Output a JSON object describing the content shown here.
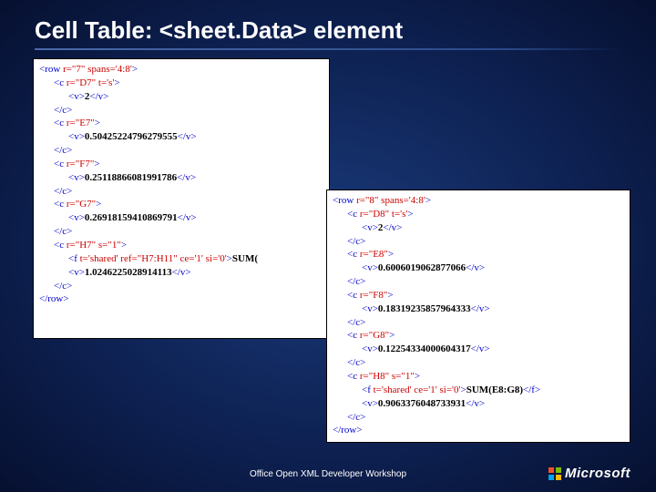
{
  "title": "Cell Table: <sheet.Data> element",
  "footer": "Office Open XML Developer Workshop",
  "brand": "Microsoft",
  "left_box": [
    {
      "cls": "ln",
      "parts": [
        {
          "t": "<row ",
          "c": "tag"
        },
        {
          "t": "r=\"7\" spans='4:8'",
          "c": "attr"
        },
        {
          "t": ">",
          "c": "tag"
        }
      ]
    },
    {
      "cls": "ln ind1",
      "parts": [
        {
          "t": "<c ",
          "c": "tag"
        },
        {
          "t": "r=\"D7\" t='s'",
          "c": "attr"
        },
        {
          "t": ">",
          "c": "tag"
        }
      ]
    },
    {
      "cls": "ln ind2",
      "parts": [
        {
          "t": "<v>",
          "c": "tag"
        },
        {
          "t": "2",
          "c": "txt"
        },
        {
          "t": "</v>",
          "c": "tag"
        }
      ]
    },
    {
      "cls": "ln ind1",
      "parts": [
        {
          "t": "</c>",
          "c": "tag"
        }
      ]
    },
    {
      "cls": "ln ind1",
      "parts": [
        {
          "t": "<c ",
          "c": "tag"
        },
        {
          "t": "r=\"E7\"",
          "c": "attr"
        },
        {
          "t": ">",
          "c": "tag"
        }
      ]
    },
    {
      "cls": "ln ind2",
      "parts": [
        {
          "t": "<v>",
          "c": "tag"
        },
        {
          "t": "0.50425224796279555",
          "c": "txt"
        },
        {
          "t": "</v>",
          "c": "tag"
        }
      ]
    },
    {
      "cls": "ln ind1",
      "parts": [
        {
          "t": "</c>",
          "c": "tag"
        }
      ]
    },
    {
      "cls": "ln ind1",
      "parts": [
        {
          "t": "<c ",
          "c": "tag"
        },
        {
          "t": "r=\"F7\"",
          "c": "attr"
        },
        {
          "t": ">",
          "c": "tag"
        }
      ]
    },
    {
      "cls": "ln ind2",
      "parts": [
        {
          "t": "<v>",
          "c": "tag"
        },
        {
          "t": "0.25118866081991786",
          "c": "txt"
        },
        {
          "t": "</v>",
          "c": "tag"
        }
      ]
    },
    {
      "cls": "ln ind1",
      "parts": [
        {
          "t": "</c>",
          "c": "tag"
        }
      ]
    },
    {
      "cls": "ln ind1",
      "parts": [
        {
          "t": "<c ",
          "c": "tag"
        },
        {
          "t": "r=\"G7\"",
          "c": "attr"
        },
        {
          "t": ">",
          "c": "tag"
        }
      ]
    },
    {
      "cls": "ln ind2",
      "parts": [
        {
          "t": "<v>",
          "c": "tag"
        },
        {
          "t": "0.26918159410869791",
          "c": "txt"
        },
        {
          "t": "</v>",
          "c": "tag"
        }
      ]
    },
    {
      "cls": "ln ind1",
      "parts": [
        {
          "t": "</c>",
          "c": "tag"
        }
      ]
    },
    {
      "cls": "ln ind1",
      "parts": [
        {
          "t": "<c ",
          "c": "tag"
        },
        {
          "t": "r=\"H7\" s=\"1\"",
          "c": "attr"
        },
        {
          "t": ">",
          "c": "tag"
        }
      ]
    },
    {
      "cls": "ln ind2",
      "parts": [
        {
          "t": "<f ",
          "c": "tag"
        },
        {
          "t": "t='shared' ref=\"H7:H11\" ce='1' si='0'",
          "c": "attr"
        },
        {
          "t": ">",
          "c": "tag"
        },
        {
          "t": "SUM(",
          "c": "txt"
        }
      ]
    },
    {
      "cls": "ln ind2",
      "parts": [
        {
          "t": "<v>",
          "c": "tag"
        },
        {
          "t": "1.0246225028914113",
          "c": "txt"
        },
        {
          "t": "</v>",
          "c": "tag"
        }
      ]
    },
    {
      "cls": "ln ind1",
      "parts": [
        {
          "t": "</c>",
          "c": "tag"
        }
      ]
    },
    {
      "cls": "ln",
      "parts": [
        {
          "t": "</row>",
          "c": "tag"
        }
      ]
    }
  ],
  "right_box": [
    {
      "cls": "ln",
      "parts": [
        {
          "t": "<row ",
          "c": "tag"
        },
        {
          "t": "r=\"8\" spans='4:8'",
          "c": "attr"
        },
        {
          "t": ">",
          "c": "tag"
        }
      ]
    },
    {
      "cls": "ln ind1",
      "parts": [
        {
          "t": "<c ",
          "c": "tag"
        },
        {
          "t": "r=\"D8\" t='s'",
          "c": "attr"
        },
        {
          "t": ">",
          "c": "tag"
        }
      ]
    },
    {
      "cls": "ln ind2",
      "parts": [
        {
          "t": "<v>",
          "c": "tag"
        },
        {
          "t": "2",
          "c": "txt"
        },
        {
          "t": "</v>",
          "c": "tag"
        }
      ]
    },
    {
      "cls": "ln ind1",
      "parts": [
        {
          "t": "</c>",
          "c": "tag"
        }
      ]
    },
    {
      "cls": "ln ind1",
      "parts": [
        {
          "t": "<c ",
          "c": "tag"
        },
        {
          "t": "r=\"E8\"",
          "c": "attr"
        },
        {
          "t": ">",
          "c": "tag"
        }
      ]
    },
    {
      "cls": "ln ind2",
      "parts": [
        {
          "t": "<v>",
          "c": "tag"
        },
        {
          "t": "0.6006019062877066",
          "c": "txt"
        },
        {
          "t": "</v>",
          "c": "tag"
        }
      ]
    },
    {
      "cls": "ln ind1",
      "parts": [
        {
          "t": "</c>",
          "c": "tag"
        }
      ]
    },
    {
      "cls": "ln ind1",
      "parts": [
        {
          "t": "<c ",
          "c": "tag"
        },
        {
          "t": "r=\"F8\"",
          "c": "attr"
        },
        {
          "t": ">",
          "c": "tag"
        }
      ]
    },
    {
      "cls": "ln ind2",
      "parts": [
        {
          "t": "<v>",
          "c": "tag"
        },
        {
          "t": "0.18319235857964333",
          "c": "txt"
        },
        {
          "t": "</v>",
          "c": "tag"
        }
      ]
    },
    {
      "cls": "ln ind1",
      "parts": [
        {
          "t": "</c>",
          "c": "tag"
        }
      ]
    },
    {
      "cls": "ln ind1",
      "parts": [
        {
          "t": "<c ",
          "c": "tag"
        },
        {
          "t": "r=\"G8\"",
          "c": "attr"
        },
        {
          "t": ">",
          "c": "tag"
        }
      ]
    },
    {
      "cls": "ln ind2",
      "parts": [
        {
          "t": "<v>",
          "c": "tag"
        },
        {
          "t": "0.12254334000604317",
          "c": "txt"
        },
        {
          "t": "</v>",
          "c": "tag"
        }
      ]
    },
    {
      "cls": "ln ind1",
      "parts": [
        {
          "t": "</c>",
          "c": "tag"
        }
      ]
    },
    {
      "cls": "ln ind1",
      "parts": [
        {
          "t": "<c ",
          "c": "tag"
        },
        {
          "t": "r=\"H8\" s=\"1\"",
          "c": "attr"
        },
        {
          "t": ">",
          "c": "tag"
        }
      ]
    },
    {
      "cls": "ln ind2",
      "parts": [
        {
          "t": "<f ",
          "c": "tag"
        },
        {
          "t": "t='shared' ce='1' si='0'",
          "c": "attr"
        },
        {
          "t": ">",
          "c": "tag"
        },
        {
          "t": "SUM(E8:G8)",
          "c": "txt"
        },
        {
          "t": "</f>",
          "c": "tag"
        }
      ]
    },
    {
      "cls": "ln ind2",
      "parts": [
        {
          "t": "<v>",
          "c": "tag"
        },
        {
          "t": "0.9063376048733931",
          "c": "txt"
        },
        {
          "t": "</v>",
          "c": "tag"
        }
      ]
    },
    {
      "cls": "ln ind1",
      "parts": [
        {
          "t": "</c>",
          "c": "tag"
        }
      ]
    },
    {
      "cls": "ln",
      "parts": [
        {
          "t": "</row>",
          "c": "tag"
        }
      ]
    }
  ]
}
